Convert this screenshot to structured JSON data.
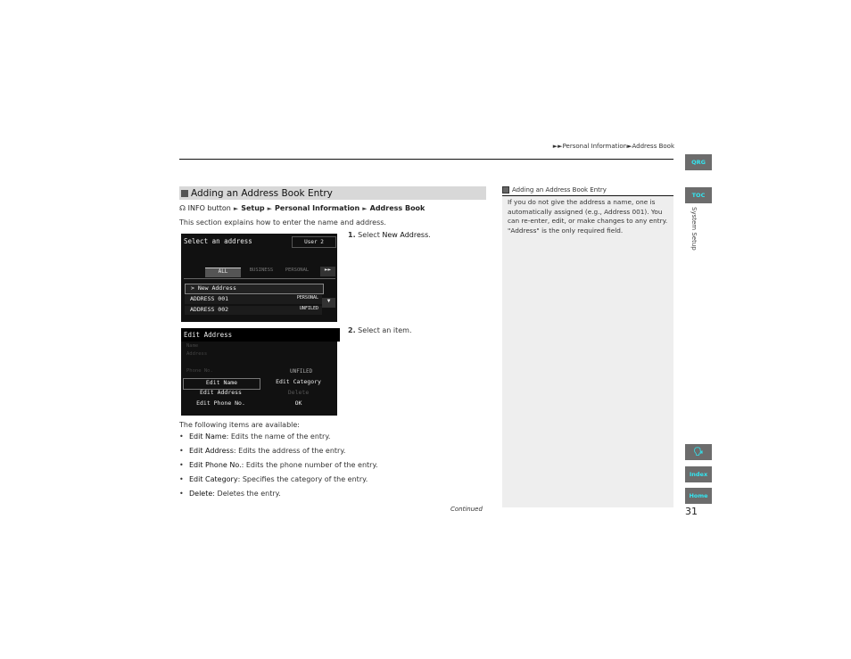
{
  "breadcrumb": {
    "arrows": "►►",
    "part1": "Personal Information",
    "sep": "►",
    "part2": "Address Book"
  },
  "side_tabs": {
    "qrg": "QRG",
    "toc": "TOC",
    "vertical_label": "System Setup",
    "voice_icon": "voice-command-icon",
    "index": "Index",
    "home": "Home"
  },
  "section": {
    "title": "Adding an Address Book Entry",
    "path": {
      "start": "INFO button",
      "sep": "►",
      "items": [
        "Setup",
        "Personal Information",
        "Address Book"
      ]
    },
    "intro": "This section explains how to enter the name and address.",
    "steps": [
      {
        "num": "1.",
        "pre": "Select ",
        "bold": "New Address",
        "post": "."
      },
      {
        "num": "2.",
        "pre": "Select an item.",
        "bold": "",
        "post": ""
      }
    ],
    "screen1": {
      "title": "Select an address",
      "user": "User 2",
      "tabs": [
        "ALL",
        "BUSINESS",
        "PERSONAL"
      ],
      "more": "►►",
      "rows": [
        {
          "name": "> New Address",
          "cat": ""
        },
        {
          "name": "ADDRESS 001",
          "cat": "PERSONAL"
        },
        {
          "name": "ADDRESS 002",
          "cat": "UNFILED"
        }
      ]
    },
    "screen2": {
      "title": "Edit Address",
      "faded": [
        "Name",
        "Address",
        "Phone No."
      ],
      "category": "UNFILED",
      "buttons": [
        [
          "Edit Name",
          "Edit Category"
        ],
        [
          "Edit Address",
          "Delete"
        ],
        [
          "Edit Phone No.",
          "OK"
        ]
      ]
    },
    "available_intro": "The following items are available:",
    "bullets": [
      {
        "term": "Edit Name",
        "desc": ": Edits the name of the entry."
      },
      {
        "term": "Edit Address",
        "desc": ": Edits the address of the entry."
      },
      {
        "term": "Edit Phone No.",
        "desc": ": Edits the phone number of the entry."
      },
      {
        "term": "Edit Category",
        "desc": ": Specifies the category of the entry."
      },
      {
        "term": "Delete",
        "desc": ": Deletes the entry."
      }
    ],
    "continued": "Continued"
  },
  "note": {
    "title": "Adding an Address Book Entry",
    "body": [
      "If you do not give the address a name, one is",
      "automatically assigned (e.g., Address 001). You",
      "can re-enter, edit, or make changes to any entry.",
      "\"Address\" is the only required field."
    ]
  },
  "page_number": "31"
}
